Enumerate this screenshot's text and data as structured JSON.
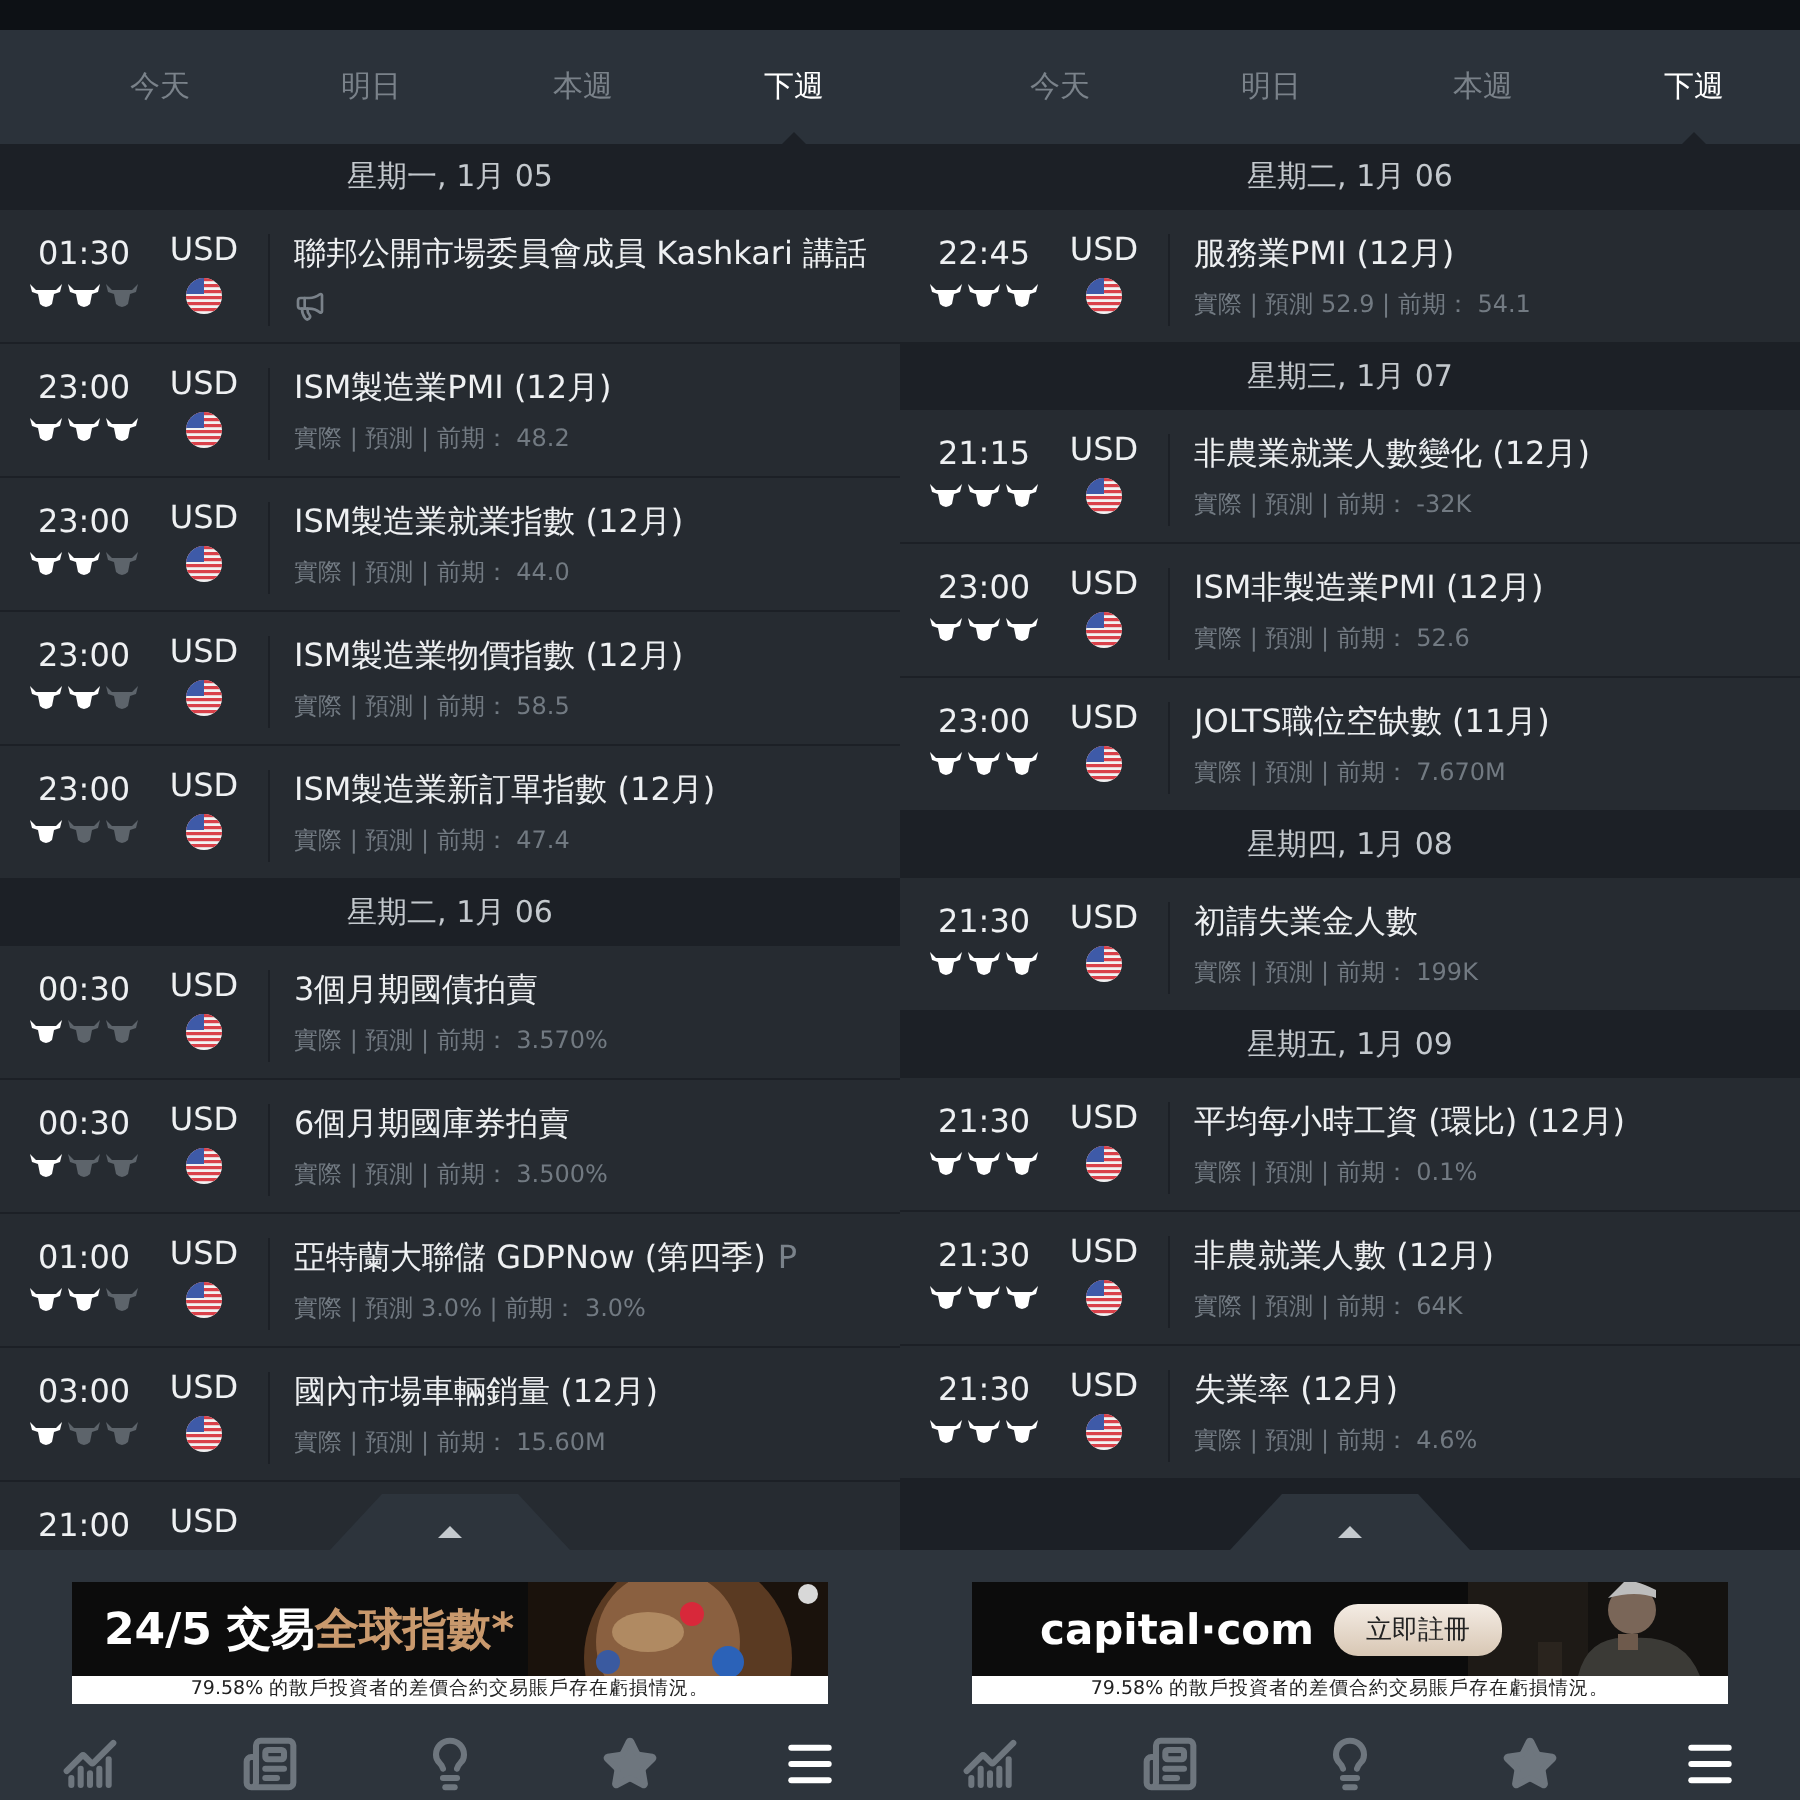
{
  "panels": [
    {
      "tabs": [
        {
          "label": "今天",
          "selected": false
        },
        {
          "label": "明日",
          "selected": false
        },
        {
          "label": "本週",
          "selected": false
        },
        {
          "label": "下週",
          "selected": true
        }
      ],
      "items": [
        {
          "kind": "date",
          "label": "星期一, 1月 05"
        },
        {
          "kind": "event",
          "time": "01:30",
          "currency": "USD",
          "stars": 2,
          "title": "聯邦公開市場委員會成員 Kashkari 講話",
          "speech": true
        },
        {
          "kind": "event",
          "time": "23:00",
          "currency": "USD",
          "stars": 3,
          "title": "ISM製造業PMI (12月)",
          "detail": "實際 | 預測 | 前期： 48.2"
        },
        {
          "kind": "event",
          "time": "23:00",
          "currency": "USD",
          "stars": 2,
          "title": "ISM製造業就業指數 (12月)",
          "detail": "實際 | 預測 | 前期： 44.0"
        },
        {
          "kind": "event",
          "time": "23:00",
          "currency": "USD",
          "stars": 2,
          "title": "ISM製造業物價指數 (12月)",
          "detail": "實際 | 預測 | 前期： 58.5"
        },
        {
          "kind": "event",
          "time": "23:00",
          "currency": "USD",
          "stars": 1,
          "title": "ISM製造業新訂單指數 (12月)",
          "detail": "實際 | 預測 | 前期： 47.4"
        },
        {
          "kind": "date",
          "label": "星期二, 1月 06"
        },
        {
          "kind": "event",
          "time": "00:30",
          "currency": "USD",
          "stars": 1,
          "title": "3個月期國債拍賣",
          "detail": "實際 | 預測 | 前期： 3.570%"
        },
        {
          "kind": "event",
          "time": "00:30",
          "currency": "USD",
          "stars": 1,
          "title": "6個月期國庫券拍賣",
          "detail": "實際 | 預測 | 前期： 3.500%"
        },
        {
          "kind": "event",
          "time": "01:00",
          "currency": "USD",
          "stars": 2,
          "title": "亞特蘭大聯儲 GDPNow (第四季)",
          "suffix": "P",
          "detail": "實際 | 預測 3.0% | 前期： 3.0%"
        },
        {
          "kind": "event",
          "time": "03:00",
          "currency": "USD",
          "stars": 1,
          "title": "國內市場車輛銷量 (12月)",
          "detail": "實際 | 預測 | 前期： 15.60M"
        },
        {
          "kind": "partial",
          "time": "21:00",
          "currency": "USD"
        }
      ],
      "ad": {
        "kind": "indices",
        "headline": "24/5 交易",
        "highlight": "全球指數*",
        "disclaimer": "79.58% 的散戶投資者的差價合約交易賬戶存在虧損情況。"
      },
      "nav": [
        {
          "kind": "chart",
          "selected": false
        },
        {
          "kind": "news",
          "selected": false
        },
        {
          "kind": "idea",
          "selected": false
        },
        {
          "kind": "star",
          "selected": false
        },
        {
          "kind": "menu",
          "selected": true
        }
      ]
    },
    {
      "tabs": [
        {
          "label": "今天",
          "selected": false
        },
        {
          "label": "明日",
          "selected": false
        },
        {
          "label": "本週",
          "selected": false
        },
        {
          "label": "下週",
          "selected": true
        }
      ],
      "items": [
        {
          "kind": "date",
          "label": "星期二, 1月 06"
        },
        {
          "kind": "event",
          "time": "22:45",
          "currency": "USD",
          "stars": 3,
          "title": "服務業PMI (12月)",
          "detail": "實際 | 預測 52.9 | 前期： 54.1"
        },
        {
          "kind": "date",
          "label": "星期三, 1月 07"
        },
        {
          "kind": "event",
          "time": "21:15",
          "currency": "USD",
          "stars": 3,
          "title": "非農業就業人數變化 (12月)",
          "detail": "實際 | 預測 | 前期： -32K"
        },
        {
          "kind": "event",
          "time": "23:00",
          "currency": "USD",
          "stars": 3,
          "title": "ISM非製造業PMI (12月)",
          "detail": "實際 | 預測 | 前期： 52.6"
        },
        {
          "kind": "event",
          "time": "23:00",
          "currency": "USD",
          "stars": 3,
          "title": "JOLTS職位空缺數 (11月)",
          "detail": "實際 | 預測 | 前期： 7.670M"
        },
        {
          "kind": "date",
          "label": "星期四, 1月 08"
        },
        {
          "kind": "event",
          "time": "21:30",
          "currency": "USD",
          "stars": 3,
          "title": "初請失業金人數",
          "detail": "實際 | 預測 | 前期： 199K"
        },
        {
          "kind": "date",
          "label": "星期五, 1月 09"
        },
        {
          "kind": "event",
          "time": "21:30",
          "currency": "USD",
          "stars": 3,
          "title": "平均每小時工資 (環比) (12月)",
          "detail": "實際 | 預測 | 前期： 0.1%"
        },
        {
          "kind": "event",
          "time": "21:30",
          "currency": "USD",
          "stars": 3,
          "title": "非農就業人數 (12月)",
          "detail": "實際 | 預測 | 前期： 64K"
        },
        {
          "kind": "event",
          "time": "21:30",
          "currency": "USD",
          "stars": 3,
          "title": "失業率 (12月)",
          "detail": "實際 | 預測 | 前期： 4.6%"
        }
      ],
      "ad": {
        "kind": "broker",
        "logo": "capital·com",
        "button": "立即註冊",
        "disclaimer": "79.58% 的散戶投資者的差價合約交易賬戶存在虧損情況。"
      },
      "nav": [
        {
          "kind": "chart",
          "selected": false
        },
        {
          "kind": "news",
          "selected": false
        },
        {
          "kind": "idea",
          "selected": false
        },
        {
          "kind": "star",
          "selected": false
        },
        {
          "kind": "menu",
          "selected": true
        }
      ]
    }
  ]
}
